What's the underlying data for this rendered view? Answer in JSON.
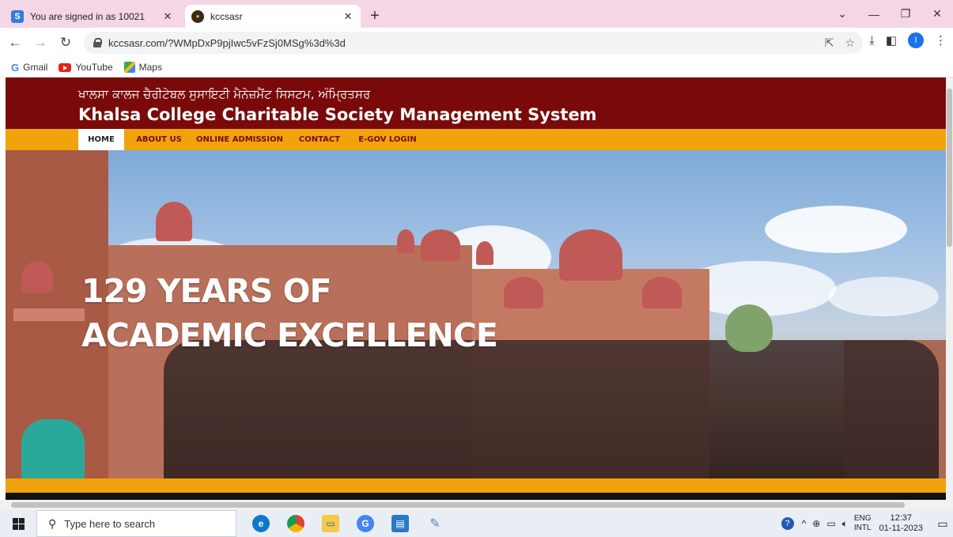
{
  "browser": {
    "tabs": [
      {
        "title": "You are signed in as 10021",
        "favicon": "S"
      },
      {
        "title": "kccsasr",
        "favicon": "●"
      }
    ],
    "new_tab": "+",
    "url": "kccsasr.com/?WMpDxP9pjIwc5vFzSj0MSg%3d%3d",
    "profile_initial": "I",
    "bookmarks": [
      {
        "label": "Gmail",
        "icon": "G"
      },
      {
        "label": "YouTube",
        "icon": "youtube-icon"
      },
      {
        "label": "Maps",
        "icon": "maps-icon"
      }
    ]
  },
  "site": {
    "title_punjabi": "ਖਾਲਸਾ ਕਾਲਜ ਚੈਰੀਟੇਬਲ ਸੁਸਾਇਟੀ ਮੈਨੇਜ਼ਮੈਂਟ ਸਿਸਟਮ, ਅੰਮ੍ਰਿਤਸਰ",
    "title_english": "Khalsa College Charitable Society Management System",
    "menu": [
      "HOME",
      "ABOUT US",
      "ONLINE ADMISSION",
      "CONTACT",
      "E-GOV LOGIN"
    ],
    "active_menu": "HOME",
    "hero_text": "129 YEARS OF ACADEMIC EXCELLENCE",
    "colors": {
      "header": "#7a0a0a",
      "menubar": "#f0a30a"
    }
  },
  "taskbar": {
    "search_placeholder": "Type here to search",
    "lang_line1": "ENG",
    "lang_line2": "INTL",
    "time": "12:37",
    "date": "01-11-2023"
  }
}
